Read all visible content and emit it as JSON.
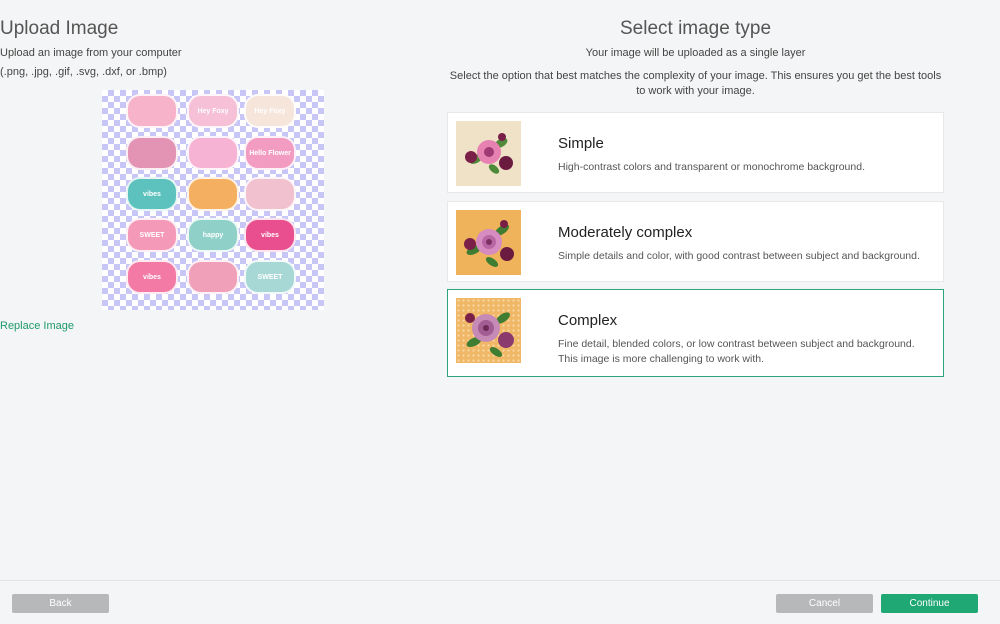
{
  "upload": {
    "title": "Upload Image",
    "subtitle": "Upload an image from your computer",
    "formats": "(.png, .jpg, .gif, .svg, .dxf, or .bmp)",
    "replace_label": "Replace Image",
    "stickers": [
      {
        "text": "",
        "color": "#f7b3c9"
      },
      {
        "text": "Hey Foxy",
        "color": "#f6c0d6"
      },
      {
        "text": "Hey Foxy",
        "color": "#f5e5da"
      },
      {
        "text": "",
        "color": "#e394b5"
      },
      {
        "text": "",
        "color": "#f7b3d4"
      },
      {
        "text": "Hello Flower",
        "color": "#f29cc2"
      },
      {
        "text": "vibes",
        "color": "#5dc2bd"
      },
      {
        "text": "",
        "color": "#f4b060"
      },
      {
        "text": "",
        "color": "#f1c1cf"
      },
      {
        "text": "SWEET",
        "color": "#f49ab8"
      },
      {
        "text": "happy",
        "color": "#8fd0c8"
      },
      {
        "text": "vibes",
        "color": "#e94f8e"
      },
      {
        "text": "vibes",
        "color": "#f27aa4"
      },
      {
        "text": "",
        "color": "#f0a0b8"
      },
      {
        "text": "SWEET",
        "color": "#a8d8d6"
      }
    ]
  },
  "select": {
    "title": "Select image type",
    "subtitle": "Your image will be uploaded as a single layer",
    "instructions": "Select the option that best matches the complexity of your image. This ensures you get the best tools to work with your image.",
    "options": [
      {
        "title": "Simple",
        "description": "High-contrast colors and transparent or monochrome background.",
        "thumb_bg": "#efe2c6",
        "selected": false
      },
      {
        "title": "Moderately complex",
        "description": "Simple details and color, with good contrast between subject and background.",
        "thumb_bg": "#eeb35b",
        "selected": false
      },
      {
        "title": "Complex",
        "description": "Fine detail, blended colors, or low contrast between subject and background. This image is more challenging to work with.",
        "thumb_bg": "#f0b866",
        "selected": true
      }
    ]
  },
  "footer": {
    "back_label": "Back",
    "cancel_label": "Cancel",
    "continue_label": "Continue"
  },
  "colors": {
    "accent": "#1fa774",
    "link": "#1f9a6b",
    "disabled": "#b7b8ba",
    "checker": "#c7c6f7"
  }
}
